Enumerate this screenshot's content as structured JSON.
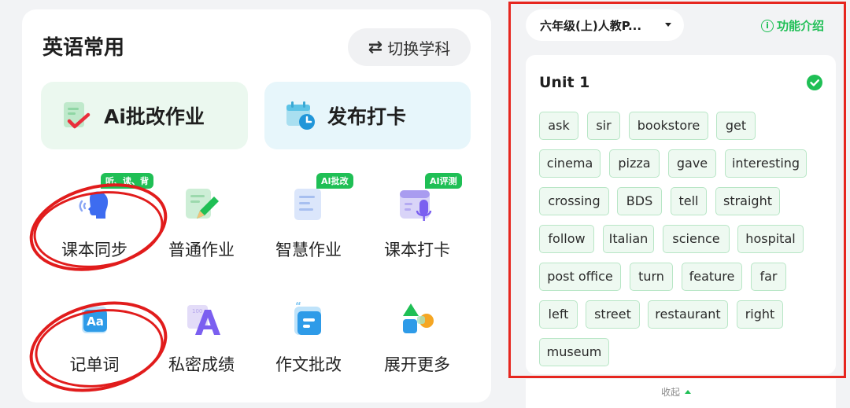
{
  "left": {
    "title": "英语常用",
    "switch_label": "切换学科",
    "cards": [
      {
        "label": "Ai批改作业"
      },
      {
        "label": "发布打卡"
      }
    ],
    "grid": [
      {
        "label": "课本同步",
        "badge": "听、读、背"
      },
      {
        "label": "普通作业",
        "badge": ""
      },
      {
        "label": "智慧作业",
        "badge": "AI批改"
      },
      {
        "label": "课本打卡",
        "badge": "AI评测"
      },
      {
        "label": "记单词",
        "badge": ""
      },
      {
        "label": "私密成绩",
        "badge": ""
      },
      {
        "label": "作文批改",
        "badge": ""
      },
      {
        "label": "展开更多",
        "badge": ""
      }
    ]
  },
  "right": {
    "grade_select": "六年级(上)人教P...",
    "func_intro": "功能介绍",
    "unit_title": "Unit 1",
    "words": [
      "ask",
      "sir",
      "bookstore",
      "get",
      "cinema",
      "pizza",
      "gave",
      "interesting",
      "crossing",
      "BDS",
      "tell",
      "straight",
      "follow",
      "Italian",
      "science",
      "hospital",
      "post office",
      "turn",
      "feature",
      "far",
      "left",
      "street",
      "restaurant",
      "right",
      "museum"
    ],
    "collapse_label": "收起"
  },
  "colors": {
    "accent_green": "#1fbf55",
    "annotation_red": "#e11c1c",
    "chip_bg": "#eef9f1",
    "chip_border": "#b8e6c6"
  }
}
